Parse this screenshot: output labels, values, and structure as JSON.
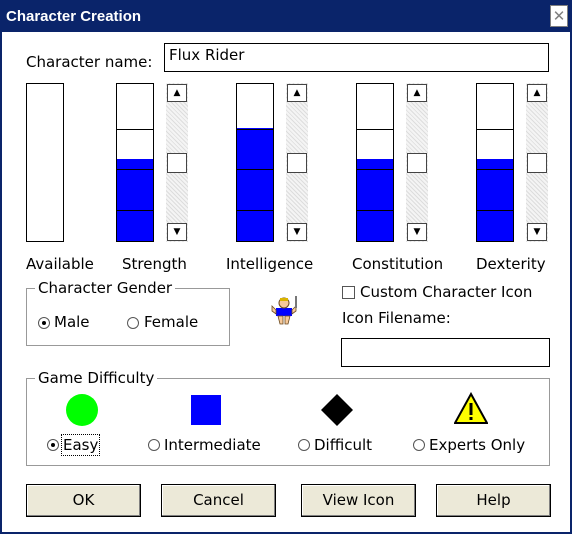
{
  "window": {
    "title": "Character Creation",
    "close_glyph": "✕"
  },
  "name_field": {
    "label": "Character name:",
    "value": "Flux Rider"
  },
  "stats": [
    {
      "label": "Available",
      "level": 0,
      "has_scroll": false
    },
    {
      "label": "Strength",
      "level": 0.52,
      "has_scroll": true
    },
    {
      "label": "Intelligence",
      "level": 0.72,
      "has_scroll": true
    },
    {
      "label": "Constitution",
      "level": 0.52,
      "has_scroll": true
    },
    {
      "label": "Dexterity",
      "level": 0.52,
      "has_scroll": true
    }
  ],
  "gender": {
    "legend": "Character Gender",
    "options": [
      "Male",
      "Female"
    ],
    "selected": "Male"
  },
  "custom_icon": {
    "checkbox_label": "Custom Character Icon",
    "checked": false,
    "filename_label": "Icon Filename:",
    "filename_value": ""
  },
  "difficulty": {
    "legend": "Game Difficulty",
    "options": [
      {
        "label": "Easy",
        "icon": "green-circle-icon",
        "color": "#00ff00"
      },
      {
        "label": "Intermediate",
        "icon": "blue-square-icon",
        "color": "#0000ff"
      },
      {
        "label": "Difficult",
        "icon": "black-diamond-icon",
        "color": "#000000"
      },
      {
        "label": "Experts Only",
        "icon": "warning-icon",
        "color": "#ffff00"
      }
    ],
    "selected": "Easy"
  },
  "buttons": {
    "ok": "OK",
    "cancel": "Cancel",
    "view_icon": "View Icon",
    "help": "Help"
  },
  "colors": {
    "titlebar": "#0a246a",
    "stat_fill": "#0000ff"
  }
}
